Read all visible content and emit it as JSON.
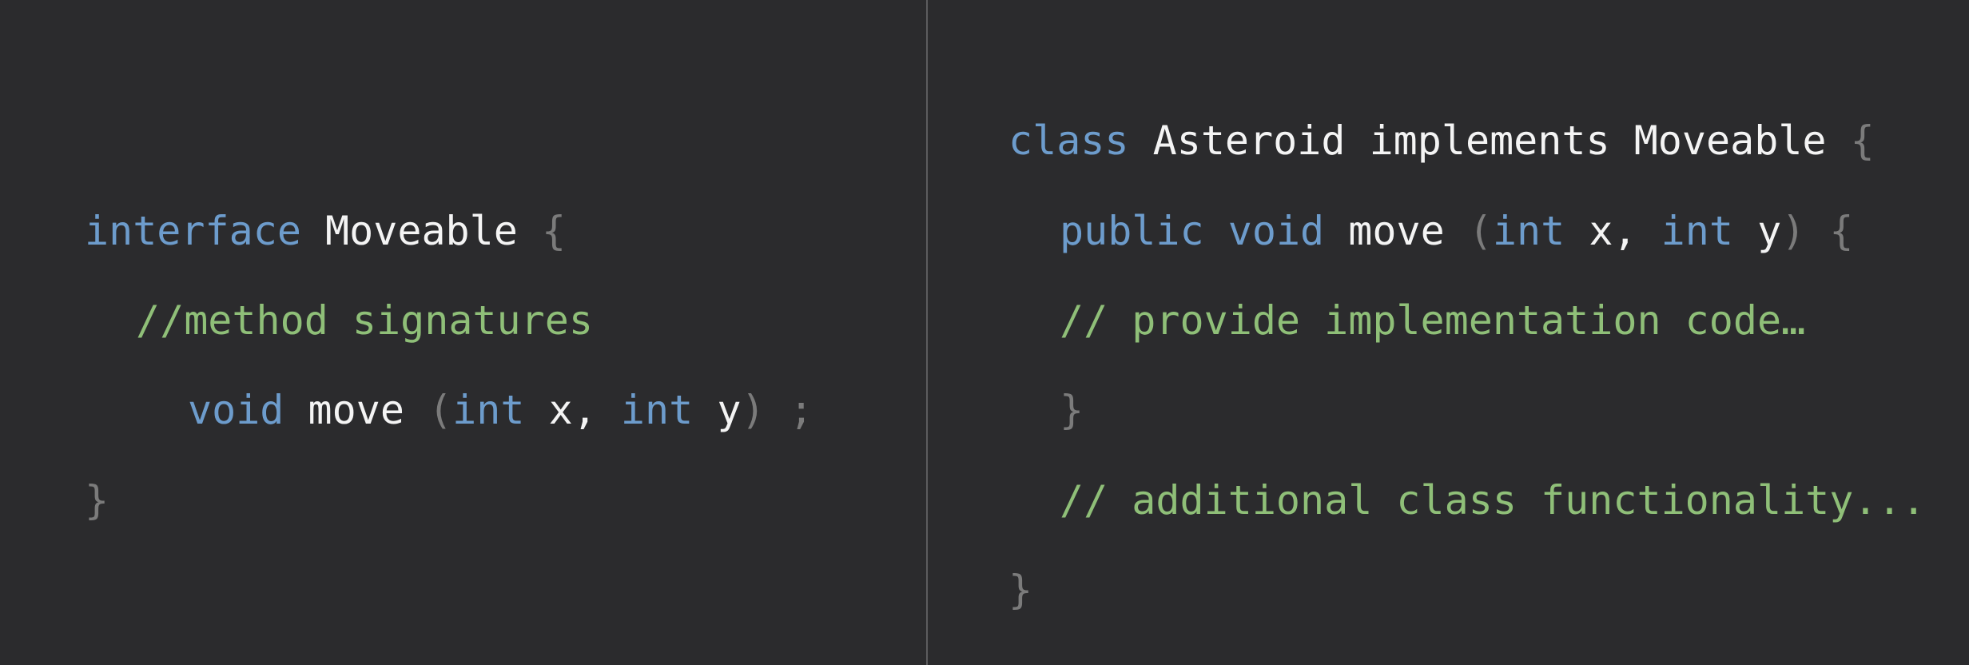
{
  "left_pane": {
    "line1": {
      "kw": "interface",
      "name": "Moveable",
      "brace": "{"
    },
    "line2": {
      "comment": "//method signatures"
    },
    "line3": {
      "ret": "void",
      "name": "move",
      "open": "(",
      "t1": "int",
      "p1": "x,",
      "t2": "int",
      "p2": "y",
      "close": ")",
      "semi": ";"
    },
    "line4": {
      "brace": "}"
    }
  },
  "right_pane": {
    "line1": {
      "kw": "class",
      "name": "Asteroid",
      "impl": "implements",
      "iface": "Moveable",
      "brace": "{"
    },
    "line2": {
      "mod": "public",
      "ret": "void",
      "name": "move",
      "open": "(",
      "t1": "int",
      "p1": "x,",
      "t2": "int",
      "p2": "y",
      "close": ")",
      "brace": "{"
    },
    "line3": {
      "comment": "// provide implementation code…"
    },
    "line4": {
      "brace": "}"
    },
    "line5": {
      "comment": "// additional class functionality..."
    },
    "line6": {
      "brace": "}"
    }
  },
  "colors": {
    "background": "#2b2b2d",
    "keyword": "#6d9ccc",
    "identifier": "#f4f4f4",
    "punctuation": "#7b7b7b",
    "comment": "#8fbf78",
    "divider": "#5c5c5e"
  }
}
